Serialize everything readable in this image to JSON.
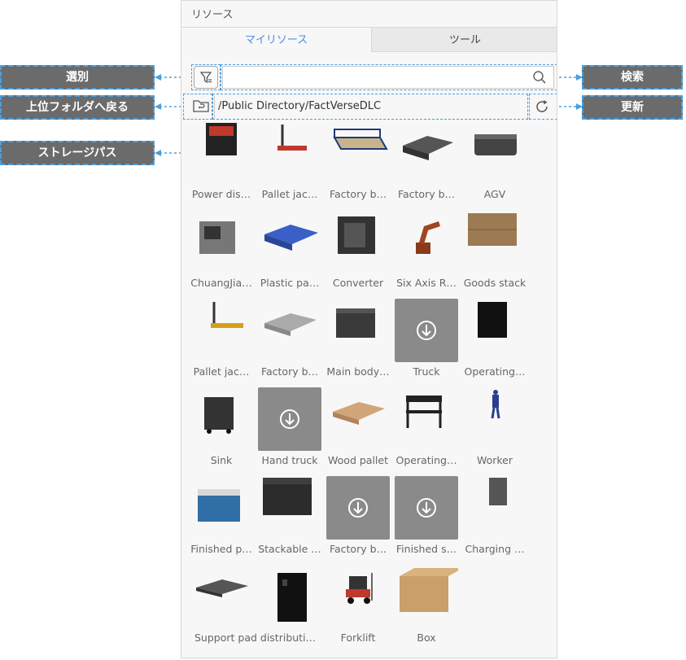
{
  "panel": {
    "title": "リソース",
    "tabs": [
      {
        "label": "マイリソース",
        "active": true
      },
      {
        "label": "ツール",
        "active": false
      }
    ],
    "search": {
      "value": "",
      "placeholder": ""
    },
    "path": "/Public Directory/FactVerseDLC"
  },
  "callouts": {
    "filter": "選別",
    "back": "上位フォルダへ戻る",
    "storage_path": "ストレージパス",
    "search": "検索",
    "refresh": "更新"
  },
  "colors": {
    "accent": "#4a8fe0",
    "callout_bg": "#6b6b6b",
    "dashed_border": "#4a9fe0"
  },
  "assets": [
    {
      "label": "Power dis…",
      "thumb": "power-distribution-cabinet",
      "download": false
    },
    {
      "label": "Pallet jac…",
      "thumb": "pallet-jack-red",
      "download": false
    },
    {
      "label": "Factory b…",
      "thumb": "factory-bin-open",
      "download": false
    },
    {
      "label": "Factory b…",
      "thumb": "factory-bin-grid",
      "download": false
    },
    {
      "label": "AGV",
      "thumb": "agv",
      "download": false
    },
    {
      "label": "ChuangJia…",
      "thumb": "machine-grey",
      "download": false
    },
    {
      "label": "Plastic pa…",
      "thumb": "plastic-pallet-blue",
      "download": false
    },
    {
      "label": "Converter",
      "thumb": "converter-cube",
      "download": false
    },
    {
      "label": "Six Axis R…",
      "thumb": "robot-arm",
      "download": false
    },
    {
      "label": "Goods stack",
      "thumb": "goods-stack",
      "download": false
    },
    {
      "label": "Pallet jac…",
      "thumb": "pallet-jack-yellow",
      "download": false
    },
    {
      "label": "Factory b…",
      "thumb": "factory-bin-tray",
      "download": false
    },
    {
      "label": "Main body…",
      "thumb": "main-body-crate",
      "download": false
    },
    {
      "label": "Truck",
      "thumb": "download",
      "download": true
    },
    {
      "label": "Operating…",
      "thumb": "operating-cabinet-black",
      "download": false
    },
    {
      "label": "Sink",
      "thumb": "sink-cart",
      "download": false
    },
    {
      "label": "Hand truck",
      "thumb": "download",
      "download": true
    },
    {
      "label": "Wood pallet",
      "thumb": "wood-pallet",
      "download": false
    },
    {
      "label": "Operating…",
      "thumb": "operating-table",
      "download": false
    },
    {
      "label": "Worker",
      "thumb": "worker",
      "download": false
    },
    {
      "label": "Finished p…",
      "thumb": "finished-box-blue",
      "download": false
    },
    {
      "label": "Stackable …",
      "thumb": "stackable-crate",
      "download": false
    },
    {
      "label": "Factory b…",
      "thumb": "download",
      "download": true
    },
    {
      "label": "Finished s…",
      "thumb": "download",
      "download": true
    },
    {
      "label": "Charging …",
      "thumb": "charging-post",
      "download": false
    },
    {
      "label": "Support pad distributi…",
      "thumb": "support-pad",
      "download": false,
      "wide": true
    },
    {
      "label": "",
      "thumb": "black-cabinet",
      "download": false,
      "spacer": true
    },
    {
      "label": "Forklift",
      "thumb": "forklift",
      "download": false
    },
    {
      "label": "Box",
      "thumb": "cardboard-box",
      "download": false
    }
  ]
}
